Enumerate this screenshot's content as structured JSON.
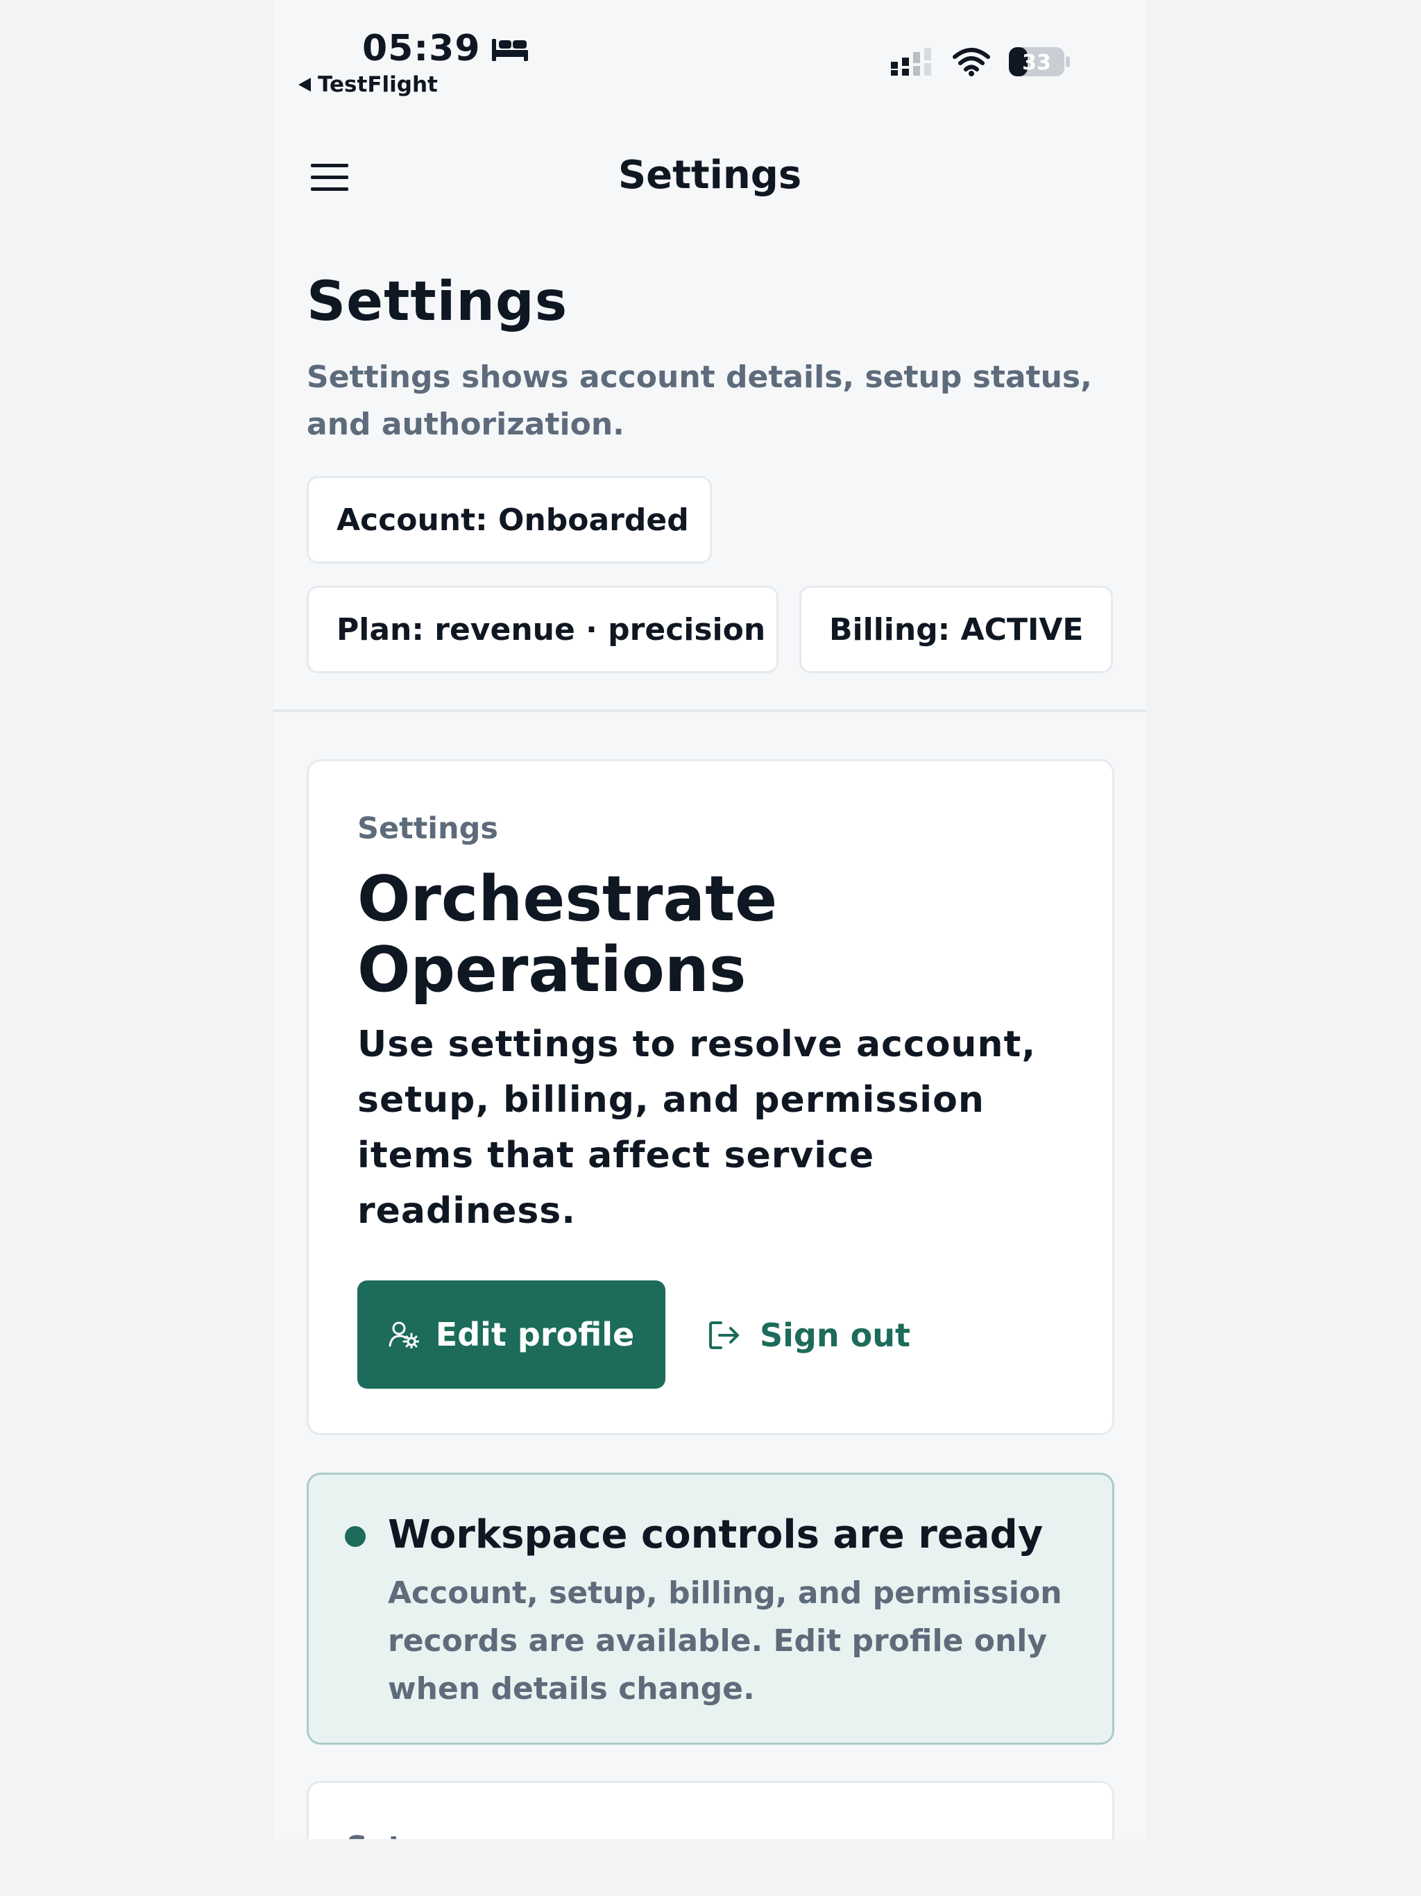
{
  "status_bar": {
    "time": "05:39",
    "back_app": "TestFlight",
    "battery_level": "33",
    "icons": [
      "bed-icon",
      "signal-icon",
      "wifi-icon",
      "battery-icon"
    ]
  },
  "nav": {
    "title": "Settings",
    "menu_icon": "hamburger-menu-icon"
  },
  "header": {
    "title": "Settings",
    "subtitle": "Settings shows account details, setup status, and authorization.",
    "chips": {
      "account": "Account: Onboarded",
      "plan": "Plan: revenue · precision",
      "billing": "Billing: ACTIVE"
    }
  },
  "hero": {
    "eyebrow": "Settings",
    "title": "Orchestrate Operations",
    "body": "Use settings to resolve account, setup, billing, and permission items that affect service readiness.",
    "edit_label": "Edit profile",
    "signout_label": "Sign out"
  },
  "ready": {
    "title": "Workspace controls are ready",
    "body": "Account, setup, billing, and permission records are available. Edit profile only when details change."
  },
  "next_section": {
    "label": "Setup"
  },
  "colors": {
    "accent": "#1c6b5b",
    "muted_text": "#5d6b7b",
    "ready_bg": "#e8f3f1"
  }
}
